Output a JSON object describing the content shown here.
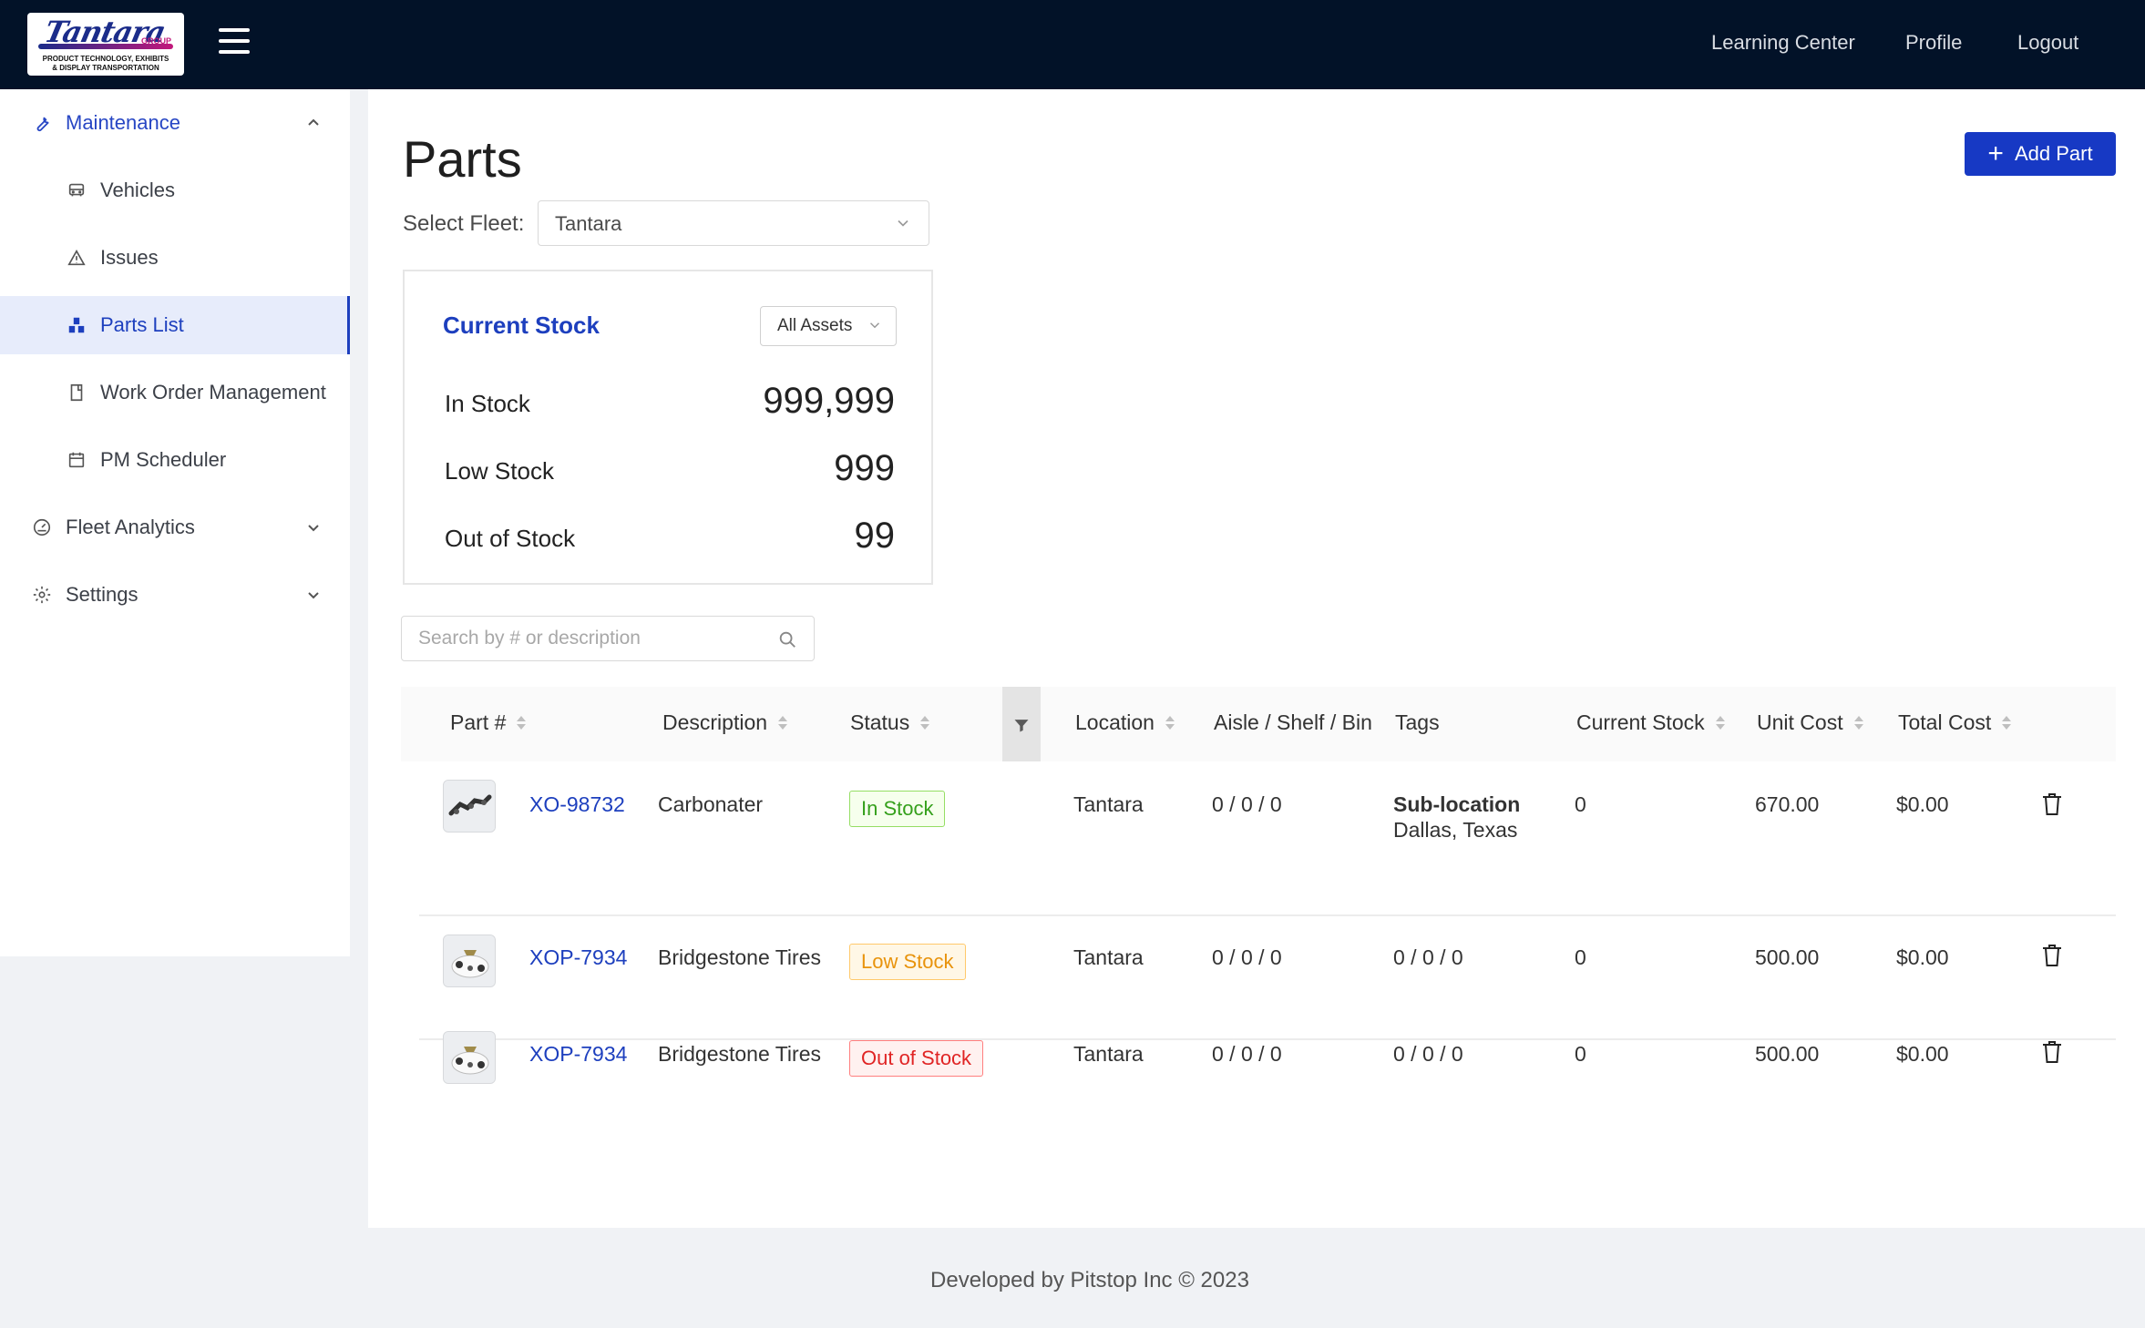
{
  "header": {
    "logo": {
      "script_text": "Tantara",
      "group_text": "GROUP",
      "tagline_1": "PRODUCT TECHNOLOGY, EXHIBITS",
      "tagline_2": "& DISPLAY TRANSPORTATION"
    },
    "nav": {
      "learning_center": "Learning Center",
      "profile": "Profile",
      "logout": "Logout"
    }
  },
  "sidebar": {
    "maintenance": "Maintenance",
    "vehicles": "Vehicles",
    "issues": "Issues",
    "parts_list": "Parts List",
    "work_order_management": "Work Order Management",
    "pm_scheduler": "PM Scheduler",
    "fleet_analytics": "Fleet Analytics",
    "settings": "Settings"
  },
  "page": {
    "title": "Parts",
    "add_part_label": "Add Part",
    "fleet_label": "Select Fleet:",
    "fleet_value": "Tantara"
  },
  "stock": {
    "title": "Current Stock",
    "asset_filter": "All Assets",
    "in_stock_label": "In Stock",
    "in_stock_value": "999,999",
    "low_stock_label": "Low Stock",
    "low_stock_value": "999",
    "out_of_stock_label": "Out of Stock",
    "out_of_stock_value": "99"
  },
  "search": {
    "placeholder": "Search by # or description"
  },
  "table": {
    "columns": {
      "part": "Part #",
      "description": "Description",
      "status": "Status",
      "location": "Location",
      "aisle": "Aisle / Shelf / Bin",
      "tags": "Tags",
      "current_stock": "Current Stock",
      "unit_cost": "Unit Cost",
      "total_cost": "Total Cost"
    },
    "rows": [
      {
        "part_no": "XO-98732",
        "description": "Carbonater",
        "status": "In Stock",
        "location": "Tantara",
        "aisle": "0 / 0 / 0",
        "tags_title": "Sub-location",
        "tags_value": "Dallas, Texas",
        "current_stock": "0",
        "unit_cost": "670.00",
        "total_cost": "$0.00"
      },
      {
        "part_no": "XOP-7934",
        "description": "Bridgestone Tires",
        "status": "Low Stock",
        "location": "Tantara",
        "aisle": "0 / 0 / 0",
        "tags": "0 / 0 / 0",
        "current_stock": "0",
        "unit_cost": "500.00",
        "total_cost": "$0.00"
      },
      {
        "part_no": "XOP-7934",
        "description": "Bridgestone Tires",
        "status": "Out of Stock",
        "location": "Tantara",
        "aisle": "0 / 0 / 0",
        "tags": "0 / 0 / 0",
        "current_stock": "0",
        "unit_cost": "500.00",
        "total_cost": "$0.00"
      }
    ]
  },
  "footer": {
    "text": "Developed by Pitstop Inc © 2023"
  },
  "colors": {
    "header_bg": "#021228",
    "accent": "#1d3fbe",
    "in_stock": "#35a01c",
    "low_stock": "#e8930c",
    "out_of_stock": "#e02424"
  }
}
